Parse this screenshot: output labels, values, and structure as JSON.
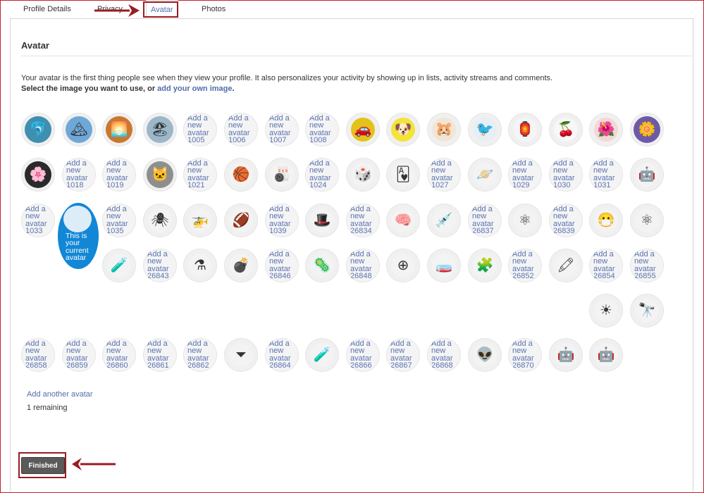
{
  "tabs": {
    "profile_details": "Profile Details",
    "privacy": "Privacy",
    "avatar": "Avatar",
    "photos": "Photos"
  },
  "section": {
    "title": "Avatar",
    "intro_line1": "Your avatar is the first thing people see when they view your profile. It also personalizes your activity by showing up in lists, activity streams and comments.",
    "intro_line2_prefix": "Select the image you want to use, or ",
    "intro_line2_link": "add your own image",
    "intro_line2_suffix": "."
  },
  "add_prefix": "Add a new avatar",
  "current_label": "This is your current avatar",
  "avatars": [
    {
      "row": 0,
      "col": 0,
      "kind": "photo",
      "icon": "dolphin-icon",
      "glyph": "🐬",
      "bg": "#3e8fb0"
    },
    {
      "row": 0,
      "col": 1,
      "kind": "photo",
      "icon": "mountain-icon",
      "glyph": "🏔",
      "bg": "#6fa8d8"
    },
    {
      "row": 0,
      "col": 2,
      "kind": "photo",
      "icon": "sunset-icon",
      "glyph": "🌅",
      "bg": "#c9782e"
    },
    {
      "row": 0,
      "col": 3,
      "kind": "photo",
      "icon": "beach-child-icon",
      "glyph": "🏖",
      "bg": "#9bb7c9"
    },
    {
      "row": 0,
      "col": 4,
      "kind": "add",
      "id": "1005"
    },
    {
      "row": 0,
      "col": 5,
      "kind": "add",
      "id": "1006"
    },
    {
      "row": 0,
      "col": 6,
      "kind": "add",
      "id": "1007"
    },
    {
      "row": 0,
      "col": 7,
      "kind": "add",
      "id": "1008"
    },
    {
      "row": 0,
      "col": 8,
      "kind": "icon",
      "icon": "car-icon",
      "glyph": "🚗",
      "bg": "#e3c21a"
    },
    {
      "row": 0,
      "col": 9,
      "kind": "icon",
      "icon": "dog-icon",
      "glyph": "🐶",
      "bg": "#f3e33a"
    },
    {
      "row": 0,
      "col": 10,
      "kind": "icon",
      "icon": "mouse-icon",
      "glyph": "🐹",
      "bg": "#f0e6d6"
    },
    {
      "row": 0,
      "col": 11,
      "kind": "icon",
      "icon": "bird-icon",
      "glyph": "🐦",
      "bg": "#e7eef5"
    },
    {
      "row": 0,
      "col": 12,
      "kind": "icon",
      "icon": "lantern-icon",
      "glyph": "🏮",
      "bg": "#f5f5f5"
    },
    {
      "row": 0,
      "col": 13,
      "kind": "icon",
      "icon": "berries-icon",
      "glyph": "🍒",
      "bg": "#f7f7f7"
    },
    {
      "row": 0,
      "col": 14,
      "kind": "icon",
      "icon": "red-flower-icon",
      "glyph": "🌺",
      "bg": "#f3d7d7"
    },
    {
      "row": 0,
      "col": 15,
      "kind": "photo",
      "icon": "purple-flower-icon",
      "glyph": "🌼",
      "bg": "#6c5aa8"
    },
    {
      "row": 1,
      "col": 0,
      "kind": "photo",
      "icon": "white-flower-icon",
      "glyph": "🌸",
      "bg": "#2a2a2a"
    },
    {
      "row": 1,
      "col": 1,
      "kind": "add",
      "id": "1018"
    },
    {
      "row": 1,
      "col": 2,
      "kind": "add",
      "id": "1019"
    },
    {
      "row": 1,
      "col": 3,
      "kind": "photo",
      "icon": "cat-icon",
      "glyph": "🐱",
      "bg": "#8e8e8e"
    },
    {
      "row": 1,
      "col": 4,
      "kind": "add",
      "id": "1021"
    },
    {
      "row": 1,
      "col": 5,
      "kind": "icon",
      "icon": "basketball-icon",
      "glyph": "🏀",
      "bg": "#f3f3f3"
    },
    {
      "row": 1,
      "col": 6,
      "kind": "icon",
      "icon": "bowling-ball-icon",
      "glyph": "🎳",
      "bg": "#f3f3f3"
    },
    {
      "row": 1,
      "col": 7,
      "kind": "add",
      "id": "1024"
    },
    {
      "row": 1,
      "col": 8,
      "kind": "icon",
      "icon": "dice-icon",
      "glyph": "🎲",
      "bg": "#f3f3f3"
    },
    {
      "row": 1,
      "col": 9,
      "kind": "icon",
      "icon": "playing-card-icon",
      "glyph": "🂱",
      "bg": "#f3f3f3"
    },
    {
      "row": 1,
      "col": 10,
      "kind": "add",
      "id": "1027"
    },
    {
      "row": 1,
      "col": 11,
      "kind": "icon",
      "icon": "planet-icon",
      "glyph": "🪐",
      "bg": "#f3f3f3"
    },
    {
      "row": 1,
      "col": 12,
      "kind": "add",
      "id": "1029"
    },
    {
      "row": 1,
      "col": 13,
      "kind": "add",
      "id": "1030"
    },
    {
      "row": 1,
      "col": 14,
      "kind": "add",
      "id": "1031"
    },
    {
      "row": 1,
      "col": 15,
      "kind": "icon",
      "icon": "robot-toy-icon",
      "glyph": "🤖",
      "bg": "#f3f3f3"
    },
    {
      "row": 2,
      "col": 0,
      "kind": "add",
      "id": "1033"
    },
    {
      "row": 2,
      "col": 2,
      "kind": "add",
      "id": "1035"
    },
    {
      "row": 2,
      "col": 3,
      "kind": "icon",
      "icon": "spider-icon",
      "glyph": "🕷",
      "bg": "#f3f3f3"
    },
    {
      "row": 2,
      "col": 4,
      "kind": "icon",
      "icon": "helicopter-icon",
      "glyph": "🚁",
      "bg": "#f3f3f3"
    },
    {
      "row": 2,
      "col": 5,
      "kind": "icon",
      "icon": "football-icon",
      "glyph": "🏈",
      "bg": "#f3f3f3"
    },
    {
      "row": 2,
      "col": 6,
      "kind": "add",
      "id": "1039"
    },
    {
      "row": 2,
      "col": 7,
      "kind": "icon",
      "icon": "hat-icon",
      "glyph": "🎩",
      "bg": "#f3f3f3"
    },
    {
      "row": 2,
      "col": 8,
      "kind": "add",
      "id": "26834"
    },
    {
      "row": 2,
      "col": 9,
      "kind": "icon",
      "icon": "brain-gears-icon",
      "glyph": "🧠",
      "bg": "#f3f3f3"
    },
    {
      "row": 2,
      "col": 10,
      "kind": "icon",
      "icon": "dropper-icon",
      "glyph": "💉",
      "bg": "#f3f3f3"
    },
    {
      "row": 2,
      "col": 11,
      "kind": "add",
      "id": "26837"
    },
    {
      "row": 2,
      "col": 12,
      "kind": "icon",
      "icon": "molecule-icon",
      "glyph": "⚛",
      "bg": "#f3f3f3"
    },
    {
      "row": 2,
      "col": 13,
      "kind": "add",
      "id": "26839"
    },
    {
      "row": 2,
      "col": 14,
      "kind": "icon",
      "icon": "gas-mask-icon",
      "glyph": "😷",
      "bg": "#f3f3f3"
    },
    {
      "row": 2,
      "col": 15,
      "kind": "icon",
      "icon": "atom-icon",
      "glyph": "⚛",
      "bg": "#f3f3f3"
    },
    {
      "row": 3,
      "col": 2,
      "kind": "icon",
      "icon": "test-tubes-icon",
      "glyph": "🧪",
      "bg": "#f3f3f3"
    },
    {
      "row": 3,
      "col": 3,
      "kind": "add",
      "id": "26843"
    },
    {
      "row": 3,
      "col": 4,
      "kind": "icon",
      "icon": "flask-icon",
      "glyph": "⚗",
      "bg": "#f3f3f3"
    },
    {
      "row": 3,
      "col": 5,
      "kind": "icon",
      "icon": "bomb-icon",
      "glyph": "💣",
      "bg": "#f3f3f3"
    },
    {
      "row": 3,
      "col": 6,
      "kind": "add",
      "id": "26846"
    },
    {
      "row": 3,
      "col": 7,
      "kind": "icon",
      "icon": "virus-icon",
      "glyph": "🦠",
      "bg": "#f3f3f3"
    },
    {
      "row": 3,
      "col": 8,
      "kind": "add",
      "id": "26848"
    },
    {
      "row": 3,
      "col": 9,
      "kind": "icon",
      "icon": "particles-icon",
      "glyph": "⊕",
      "bg": "#f3f3f3"
    },
    {
      "row": 3,
      "col": 10,
      "kind": "icon",
      "icon": "beakers-icon",
      "glyph": "🧫",
      "bg": "#f3f3f3"
    },
    {
      "row": 3,
      "col": 11,
      "kind": "icon",
      "icon": "puzzle-icon",
      "glyph": "🧩",
      "bg": "#f3f3f3"
    },
    {
      "row": 3,
      "col": 12,
      "kind": "add",
      "id": "26852"
    },
    {
      "row": 3,
      "col": 13,
      "kind": "icon",
      "icon": "pipette-icon",
      "glyph": "🖍",
      "bg": "#f3f3f3"
    },
    {
      "row": 3,
      "col": 14,
      "kind": "add",
      "id": "26854"
    },
    {
      "row": 3,
      "col": 15,
      "kind": "add",
      "id": "26855"
    },
    {
      "row": 4,
      "col": 14,
      "kind": "icon",
      "icon": "solar-system-icon",
      "glyph": "☀",
      "bg": "#f3f3f3"
    },
    {
      "row": 4,
      "col": 15,
      "kind": "icon",
      "icon": "telescope-icon",
      "glyph": "🔭",
      "bg": "#f3f3f3"
    },
    {
      "row": 5,
      "col": 0,
      "kind": "add",
      "id": "26858"
    },
    {
      "row": 5,
      "col": 1,
      "kind": "add",
      "id": "26859"
    },
    {
      "row": 5,
      "col": 2,
      "kind": "add",
      "id": "26860"
    },
    {
      "row": 5,
      "col": 3,
      "kind": "add",
      "id": "26861"
    },
    {
      "row": 5,
      "col": 4,
      "kind": "add",
      "id": "26862"
    },
    {
      "row": 5,
      "col": 5,
      "kind": "icon",
      "icon": "funnel-icon",
      "glyph": "⏷",
      "bg": "#f3f3f3"
    },
    {
      "row": 5,
      "col": 6,
      "kind": "add",
      "id": "26864"
    },
    {
      "row": 5,
      "col": 7,
      "kind": "icon",
      "icon": "tube-rack-icon",
      "glyph": "🧪",
      "bg": "#f3f3f3"
    },
    {
      "row": 5,
      "col": 8,
      "kind": "add",
      "id": "26866"
    },
    {
      "row": 5,
      "col": 9,
      "kind": "add",
      "id": "26867"
    },
    {
      "row": 5,
      "col": 10,
      "kind": "add",
      "id": "26868"
    },
    {
      "row": 5,
      "col": 11,
      "kind": "icon",
      "icon": "alien-mask-icon",
      "glyph": "👽",
      "bg": "#f3f3f3"
    },
    {
      "row": 5,
      "col": 12,
      "kind": "add",
      "id": "26870"
    },
    {
      "row": 5,
      "col": 13,
      "kind": "icon",
      "icon": "robot-icon",
      "glyph": "🤖",
      "bg": "#f3f3f3"
    },
    {
      "row": 5,
      "col": 14,
      "kind": "icon",
      "icon": "robot-2-icon",
      "glyph": "🤖",
      "bg": "#f3f3f3"
    }
  ],
  "footer": {
    "add_another": "Add another avatar",
    "remaining": "1 remaining",
    "finished": "Finished"
  },
  "colors": {
    "accent": "#4f6ea8",
    "highlight": "#9b1b23",
    "current_avatar": "#1187d6"
  }
}
